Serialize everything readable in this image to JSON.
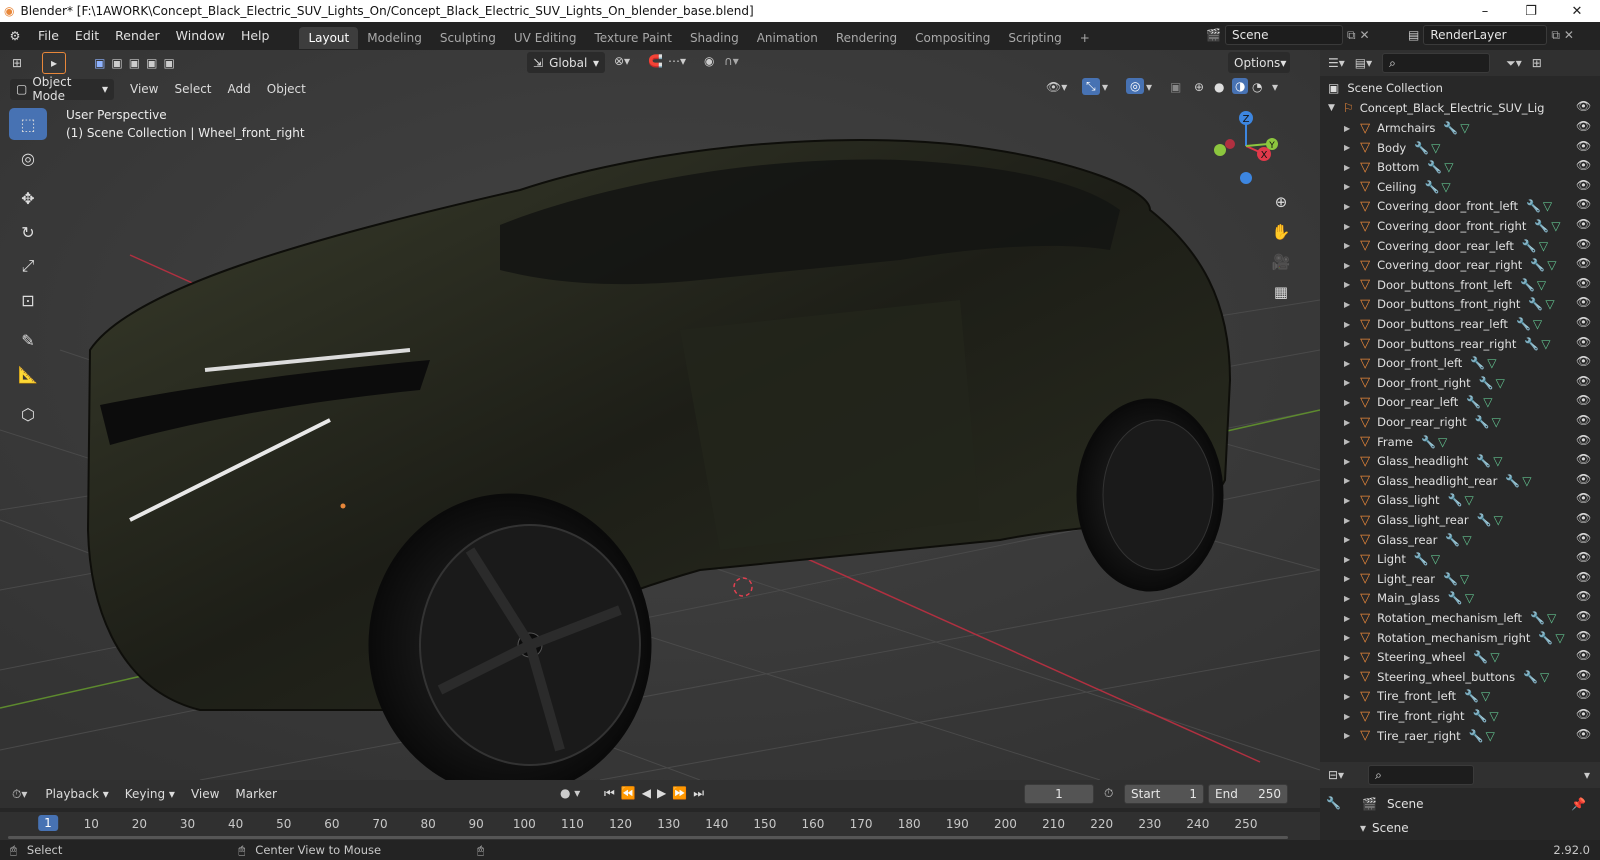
{
  "window": {
    "title": "Blender* [F:\\1AWORK\\Concept_Black_Electric_SUV_Lights_On/Concept_Black_Electric_SUV_Lights_On_blender_base.blend]",
    "minimize": "–",
    "maximize": "❐",
    "close": "✕"
  },
  "menus": [
    "File",
    "Edit",
    "Render",
    "Window",
    "Help"
  ],
  "workspaces": [
    "Layout",
    "Modeling",
    "Sculpting",
    "UV Editing",
    "Texture Paint",
    "Shading",
    "Animation",
    "Rendering",
    "Compositing",
    "Scripting"
  ],
  "add_workspace": "+",
  "scene": {
    "label": "Scene",
    "layer": "RenderLayer"
  },
  "viewport": {
    "mode": "Object Mode",
    "menus": [
      "View",
      "Select",
      "Add",
      "Object"
    ],
    "orientation": "Global",
    "options": "Options",
    "info_line1": "User Perspective",
    "info_line2": "(1) Scene Collection | Wheel_front_right",
    "gizmo": {
      "x": "X",
      "y": "Y",
      "z": "Z"
    }
  },
  "tools": [
    "select-box",
    "cursor",
    "move",
    "rotate",
    "scale",
    "transform",
    "annotate",
    "measure",
    "add-cube"
  ],
  "outliner": {
    "root": "Scene Collection",
    "collection": "Concept_Black_Electric_SUV_Lig",
    "objects": [
      "Armchairs",
      "Body",
      "Bottom",
      "Ceiling",
      "Covering_door_front_left",
      "Covering_door_front_right",
      "Covering_door_rear_left",
      "Covering_door_rear_right",
      "Door_buttons_front_left",
      "Door_buttons_front_right",
      "Door_buttons_rear_left",
      "Door_buttons_rear_right",
      "Door_front_left",
      "Door_front_right",
      "Door_rear_left",
      "Door_rear_right",
      "Frame",
      "Glass_headlight",
      "Glass_headlight_rear",
      "Glass_light",
      "Glass_light_rear",
      "Glass_rear",
      "Light",
      "Light_rear",
      "Main_glass",
      "Rotation_mechanism_left",
      "Rotation_mechanism_right",
      "Steering_wheel",
      "Steering_wheel_buttons",
      "Tire_front_left",
      "Tire_front_right",
      "Tire_raer_right"
    ]
  },
  "properties": {
    "scene_label": "Scene",
    "panel": "Scene"
  },
  "timeline": {
    "menus": [
      "Playback",
      "Keying",
      "View",
      "Marker"
    ],
    "current_frame": "1",
    "start_label": "Start",
    "start": "1",
    "end_label": "End",
    "end": "250",
    "ticks": [
      "1",
      "10",
      "20",
      "30",
      "40",
      "50",
      "60",
      "70",
      "80",
      "90",
      "100",
      "110",
      "120",
      "130",
      "140",
      "150",
      "160",
      "170",
      "180",
      "190",
      "200",
      "210",
      "220",
      "230",
      "240",
      "250"
    ]
  },
  "status": {
    "select": "Select",
    "center": "Center View to Mouse",
    "version": "2.92.0"
  },
  "colors": {
    "accent": "#4772b3",
    "orange": "#e8873a",
    "x_axis": "#e0394a",
    "y_axis": "#8cc63e",
    "z_axis": "#3d86e0"
  }
}
